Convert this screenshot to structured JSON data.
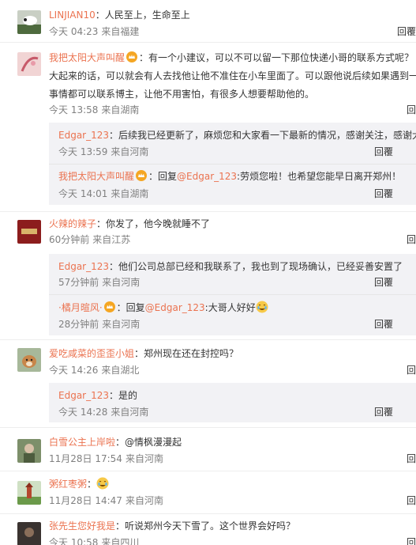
{
  "comments": [
    {
      "user": "LINJIAN10",
      "text": "：人民至上，生命至上",
      "time": "今天 04:23",
      "source": "来自福建",
      "reply_label": "回覆"
    },
    {
      "user": "我把太阳大声叫醒",
      "text_line1": "：有一个小建议，可以不可以留一下那位快递小哥的联系方式呢？",
      "text_line2": "大起来的话，可以就会有人去找他让他不准住在小车里面了。可以跟他说后续如果遇到一",
      "text_line3": "事情都可以联系博主，让他不用害怕，有很多人想要帮助他的。",
      "time": "今天 13:58",
      "source": "来自湖南",
      "reply_label": "回",
      "replies": [
        {
          "user": "Edgar_123",
          "text": "：后续我已经更新了，麻烦您和大家看一下最新的情况，感谢关注，感谢大",
          "time": "今天 13:59",
          "source": "来自河南",
          "reply_label": "回覆"
        },
        {
          "user": "我把太阳大声叫醒",
          "prefix": "：回复",
          "mention": "@Edgar_123",
          "text": ":劳烦您啦！也希望您能早日离开郑州！",
          "time": "今天 14:01",
          "source": "来自湖南",
          "reply_label": "回覆"
        }
      ]
    },
    {
      "user": "火辣的辣子",
      "text": "：你发了，他今晚就睡不了",
      "time": "60分钟前",
      "source": "来自江苏",
      "reply_label": "回",
      "replies": [
        {
          "user": "Edgar_123",
          "text": "：他们公司总部已经和我联系了，我也到了现场确认，已经妥善安置了",
          "time": "57分钟前",
          "source": "来自河南",
          "reply_label": "回覆"
        },
        {
          "user": "·橘月暄风·",
          "prefix": "：回复",
          "mention": "@Edgar_123",
          "text": ":大哥人好好",
          "time": "28分钟前",
          "source": "来自河南",
          "reply_label": "回覆"
        }
      ]
    },
    {
      "user": "爱吃咸菜的歪歪小姐",
      "text": "：郑州现在还在封控吗？",
      "time": "今天 14:26",
      "source": "来自湖北",
      "reply_label": "回",
      "replies": [
        {
          "user": "Edgar_123",
          "text": "：是的",
          "time": "今天 14:28",
          "source": "来自河南",
          "reply_label": "回覆"
        }
      ]
    },
    {
      "user": "白雪公主上岸啦",
      "text": "：@情枫漫漫起",
      "time": "11月28日 17:54",
      "source": "来自河南",
      "reply_label": "回"
    },
    {
      "user": "粥红枣粥",
      "text": "：",
      "time": "11月28日 14:47",
      "source": "来自河南",
      "reply_label": "回"
    },
    {
      "user": "张先生您好我是",
      "text": "：听说郑州今天下雪了。这个世界会好吗？",
      "time": "今天 10:58",
      "source": "来自四川",
      "reply_label": "回"
    }
  ],
  "colors": {
    "name": "#eb7350",
    "meta": "#808080",
    "reply_box": "#f2f2f5"
  },
  "icons": [
    "vip-crown-icon",
    "crying-laughing-emoji-icon"
  ]
}
